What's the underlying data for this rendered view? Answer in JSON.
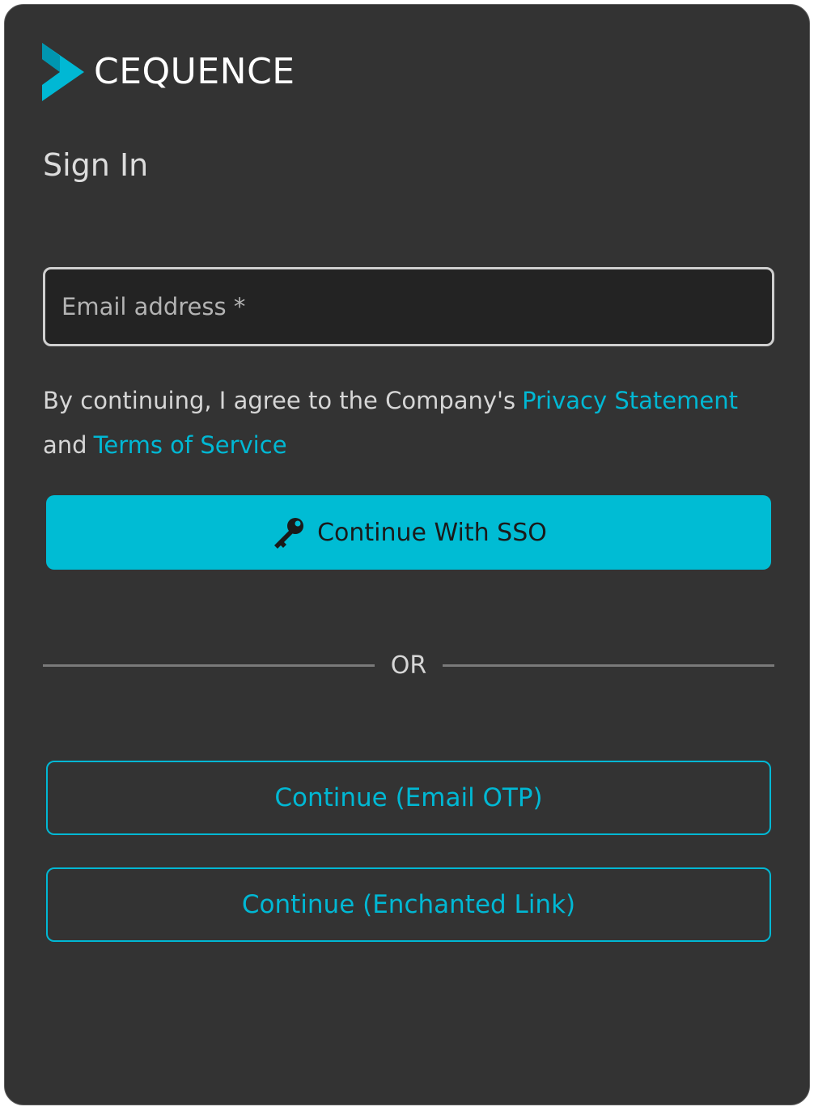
{
  "brand": {
    "name": "CEQUENCE",
    "accent_color": "#00bcd4",
    "logo_icon": "cequence-chevron-logo"
  },
  "page": {
    "title": "Sign In"
  },
  "form": {
    "email_placeholder": "Email address *",
    "email_value": ""
  },
  "consent": {
    "prefix": "By continuing, I agree to the Company's",
    "privacy_link": "Privacy Statement",
    "conjunction": "and",
    "terms_link": "Terms of Service"
  },
  "buttons": {
    "sso_label": "Continue With SSO",
    "sso_icon": "key-icon",
    "divider_label": "OR",
    "otp_label": "Continue (Email OTP)",
    "enchanted_link_label": "Continue (Enchanted Link)"
  }
}
